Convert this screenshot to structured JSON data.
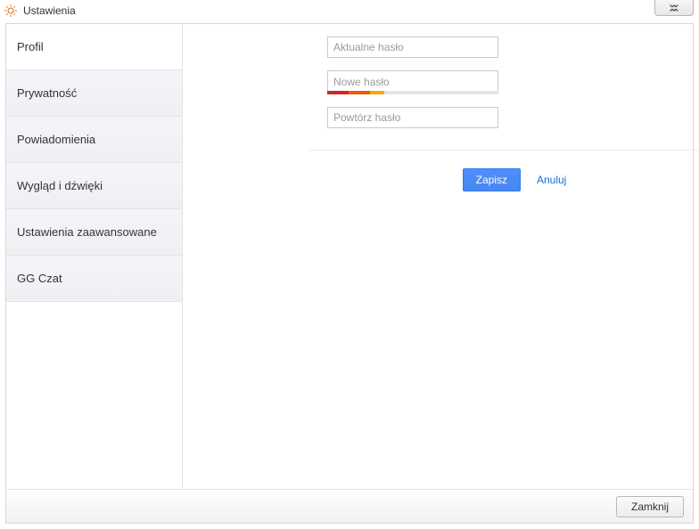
{
  "window": {
    "title": "Ustawienia"
  },
  "sidebar": {
    "items": [
      {
        "label": "Profil",
        "active": true
      },
      {
        "label": "Prywatność",
        "active": false
      },
      {
        "label": "Powiadomienia",
        "active": false
      },
      {
        "label": "Wygląd i dźwięki",
        "active": false
      },
      {
        "label": "Ustawienia zaawansowane",
        "active": false
      },
      {
        "label": "GG Czat",
        "active": false
      }
    ]
  },
  "form": {
    "current_password_placeholder": "Aktualne hasło",
    "new_password_placeholder": "Nowe hasło",
    "repeat_password_placeholder": "Powtórz hasło",
    "strength_segments": [
      {
        "color": "#d62424",
        "width": 24
      },
      {
        "color": "#e85d0f",
        "width": 24
      },
      {
        "color": "#f6a609",
        "width": 16
      }
    ],
    "save_label": "Zapisz",
    "cancel_label": "Anuluj"
  },
  "footer": {
    "close_label": "Zamknij"
  }
}
